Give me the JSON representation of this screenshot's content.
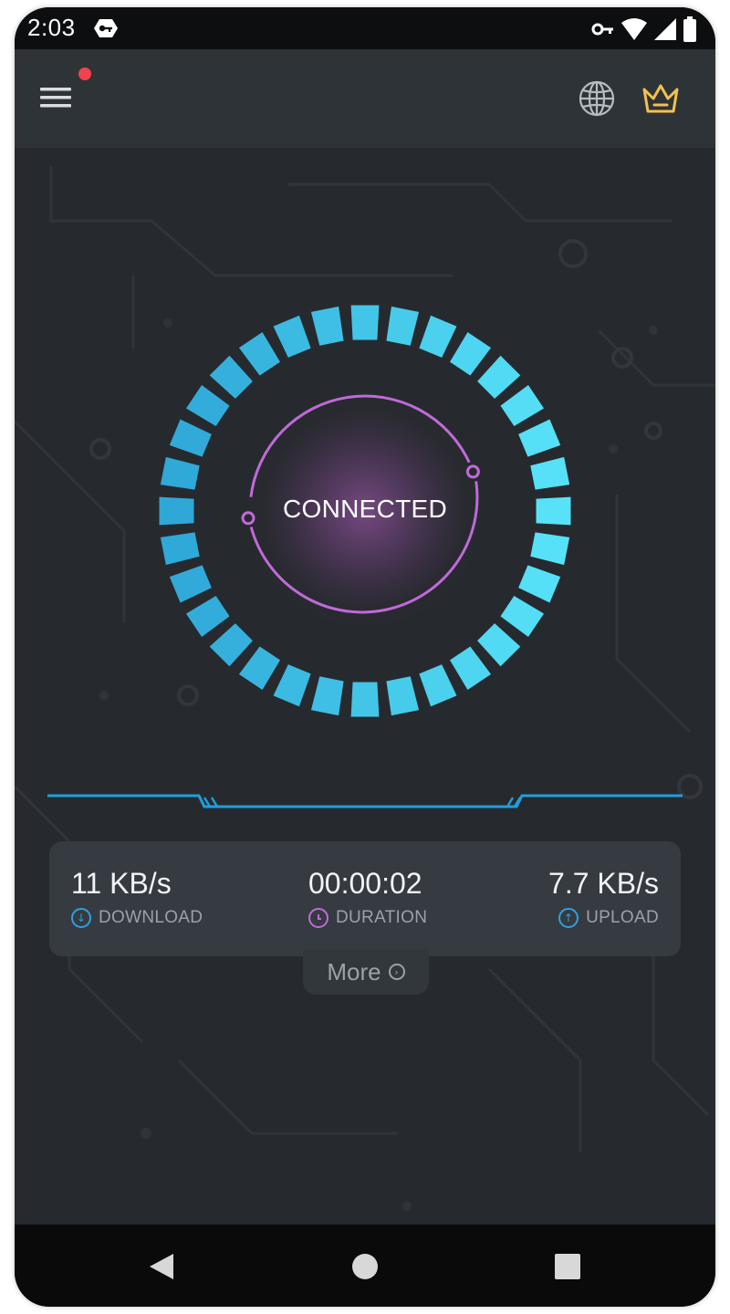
{
  "status_bar": {
    "time": "2:03",
    "icons": [
      "vpn-app-icon",
      "vpn-key-icon",
      "wifi-icon",
      "cell-signal-icon",
      "battery-icon"
    ]
  },
  "app_bar": {
    "menu_icon": "hamburger-menu-icon",
    "has_notification": true,
    "right_icons": [
      "globe-icon",
      "crown-icon"
    ]
  },
  "connection": {
    "status": "CONNECTED"
  },
  "stats": {
    "download": {
      "value": "11 KB/s",
      "label": "DOWNLOAD"
    },
    "duration": {
      "value": "00:00:02",
      "label": "DURATION"
    },
    "upload": {
      "value": "7.7 KB/s",
      "label": "UPLOAD"
    }
  },
  "more": {
    "label": "More"
  },
  "nav_bar": {
    "icons": [
      "back-icon",
      "home-icon",
      "recents-icon"
    ]
  },
  "colors": {
    "background": "#262a2e",
    "app_bar": "#2e3338",
    "ring_cyan": "#3ec4f0",
    "accent_purple": "#c06ad8",
    "download_blue": "#2f9fe0",
    "crown_gold": "#f2c14e",
    "notification_red": "#f2424c"
  }
}
